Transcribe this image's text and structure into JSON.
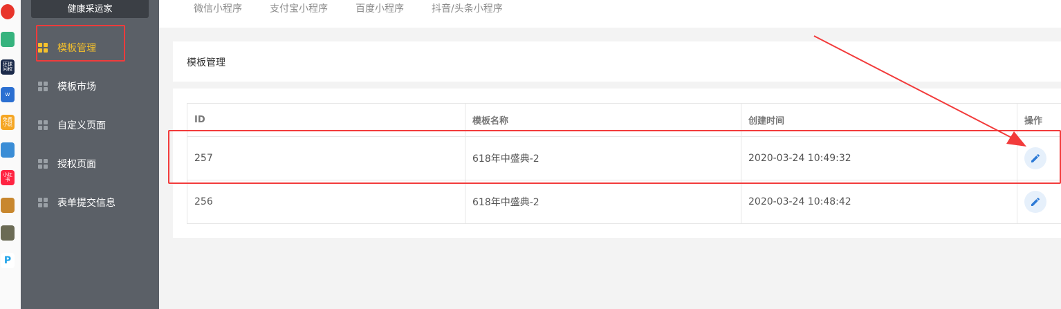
{
  "app": {
    "brand": "健康采运家"
  },
  "dock": {
    "apps": [
      {
        "icon": "weibo-app-icon",
        "color": "#e8352b",
        "label": ""
      },
      {
        "icon": "mail-app-icon",
        "color": "#36b37e",
        "label": ""
      },
      {
        "icon": "qa-app-icon",
        "color": "#1b2a4a",
        "label": "环球问权"
      },
      {
        "icon": "word-app-icon",
        "color": "#2b6fd1",
        "label": "W"
      },
      {
        "icon": "novel-app-icon",
        "color": "#f5a623",
        "label": "免费小说"
      },
      {
        "icon": "game-app-icon",
        "color": "#3a8dd6",
        "label": ""
      },
      {
        "icon": "redbook-app-icon",
        "color": "#ff2442",
        "label": "小红书"
      },
      {
        "icon": "game2-app-icon",
        "color": "#c8872e",
        "label": ""
      },
      {
        "icon": "pubg-app-icon",
        "color": "#6b6b55",
        "label": ""
      },
      {
        "icon": "pd-app-icon",
        "color": "#1fa2e8",
        "label": "P"
      }
    ]
  },
  "sidebar": {
    "items": [
      {
        "label": "模板管理",
        "active": true
      },
      {
        "label": "模板市场",
        "active": false
      },
      {
        "label": "自定义页面",
        "active": false
      },
      {
        "label": "授权页面",
        "active": false
      },
      {
        "label": "表单提交信息",
        "active": false
      }
    ]
  },
  "topbar": {
    "tabs": [
      "微信小程序",
      "支付宝小程序",
      "百度小程序",
      "抖音/头条小程序"
    ]
  },
  "page": {
    "title": "模板管理"
  },
  "table": {
    "headers": [
      "ID",
      "模板名称",
      "创建时间",
      "操作"
    ],
    "rows": [
      {
        "id": "257",
        "name": "618年中盛典-2",
        "created": "2020-03-24 10:49:32"
      },
      {
        "id": "256",
        "name": "618年中盛典-2",
        "created": "2020-03-24 10:48:42"
      }
    ]
  },
  "colors": {
    "sidebar_bg": "#5b6067",
    "active": "#f6c12c",
    "annotation": "#f23b3b",
    "edit_icon": "#2d7ad6"
  }
}
